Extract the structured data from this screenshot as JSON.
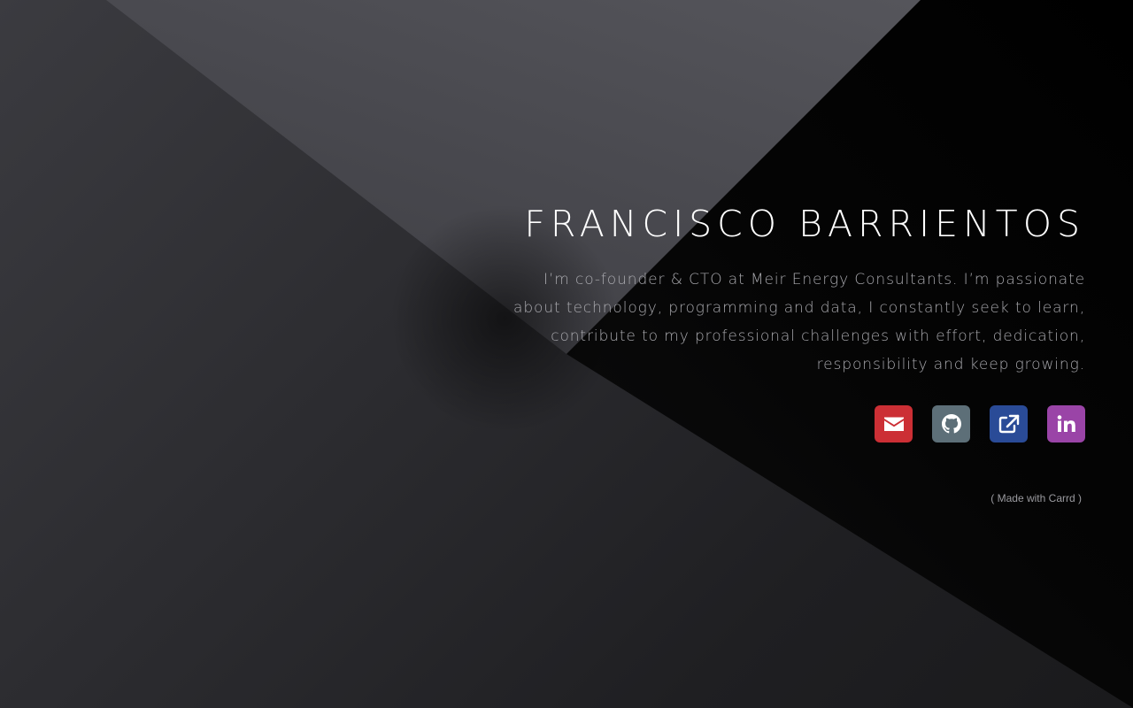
{
  "profile": {
    "name": "FRANCISCO BARRIENTOS",
    "bio": "I’m co-founder & CTO at Meir Energy Consultants. I’m passionate about technology, programming and data, I constantly seek to learn, contribute to my professional challenges with effort, dedication, responsibility and keep growing."
  },
  "social_links": [
    {
      "icon": "envelope-icon",
      "color": "#cc2f35"
    },
    {
      "icon": "github-icon",
      "color": "#5d6f78"
    },
    {
      "icon": "external-link-icon",
      "color": "#2a4b97"
    },
    {
      "icon": "linkedin-icon",
      "color": "#9a44a7"
    }
  ],
  "footer": {
    "made_with": "( Made with Carrd )"
  }
}
